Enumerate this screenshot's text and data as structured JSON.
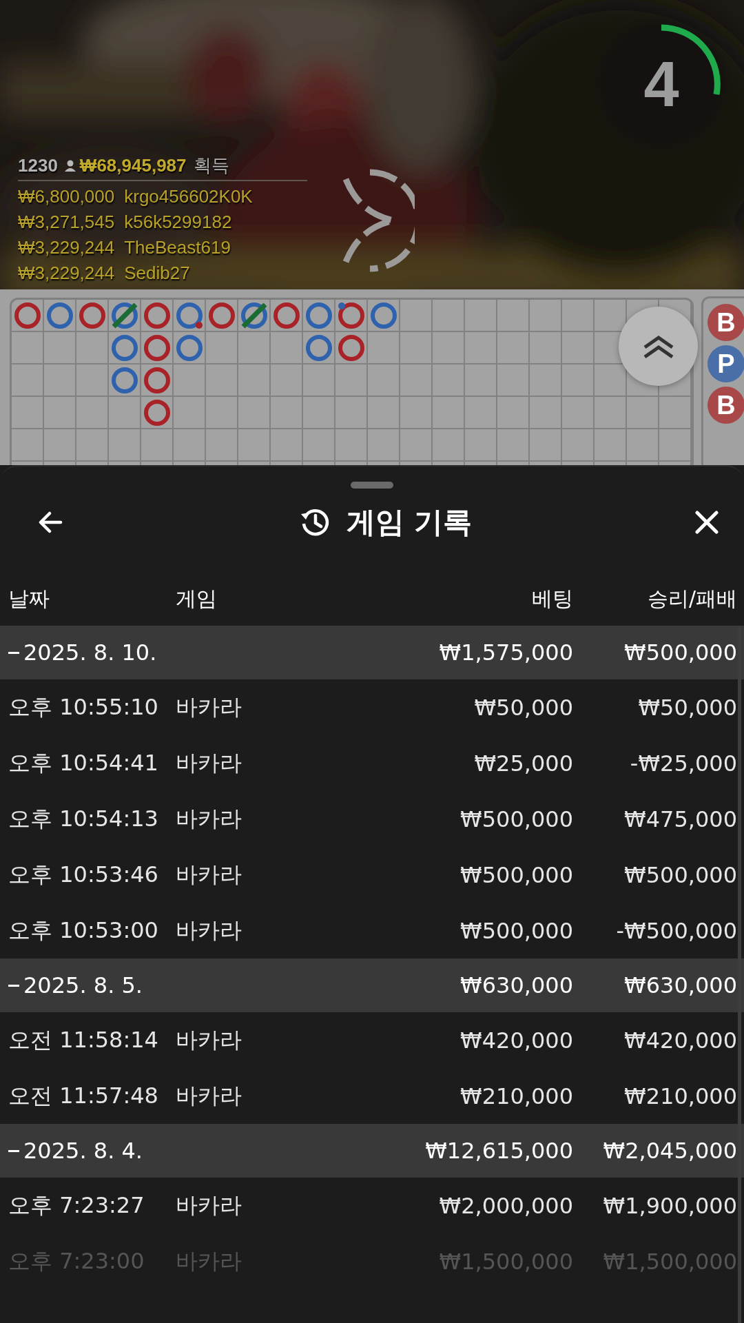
{
  "stream": {
    "kind": "picture",
    "countdown": {
      "value": "4"
    },
    "summary": {
      "players": "1230",
      "total": "₩68,945,987",
      "label": "획득"
    },
    "winners": [
      {
        "amount": "₩6,800,000",
        "name": "krgo456602K0K"
      },
      {
        "amount": "₩3,271,545",
        "name": "k56k5299182"
      },
      {
        "amount": "₩3,229,244",
        "name": "TheBeast619"
      },
      {
        "amount": "₩3,229,244",
        "name": "Sedib27"
      }
    ]
  },
  "bead_road": {
    "columns": [
      [
        {
          "kind": "banker",
          "tie": false,
          "banker_pair": false,
          "player_pair": false
        }
      ],
      [
        {
          "kind": "player",
          "tie": false,
          "banker_pair": false,
          "player_pair": false
        }
      ],
      [
        {
          "kind": "banker",
          "tie": false,
          "banker_pair": false,
          "player_pair": false
        }
      ],
      [
        {
          "kind": "player",
          "tie": true,
          "banker_pair": false,
          "player_pair": false
        },
        {
          "kind": "player",
          "tie": false,
          "banker_pair": false,
          "player_pair": false
        },
        {
          "kind": "player",
          "tie": false,
          "banker_pair": false,
          "player_pair": false
        }
      ],
      [
        {
          "kind": "banker",
          "tie": false,
          "banker_pair": false,
          "player_pair": false
        },
        {
          "kind": "banker",
          "tie": false,
          "banker_pair": false,
          "player_pair": false
        },
        {
          "kind": "banker",
          "tie": false,
          "banker_pair": false,
          "player_pair": false
        },
        {
          "kind": "banker",
          "tie": false,
          "banker_pair": false,
          "player_pair": false
        }
      ],
      [
        {
          "kind": "player",
          "tie": false,
          "banker_pair": true,
          "player_pair": false
        },
        {
          "kind": "player",
          "tie": false,
          "banker_pair": false,
          "player_pair": false
        }
      ],
      [
        {
          "kind": "banker",
          "tie": false,
          "banker_pair": false,
          "player_pair": false
        }
      ],
      [
        {
          "kind": "player",
          "tie": true,
          "banker_pair": false,
          "player_pair": false
        }
      ],
      [
        {
          "kind": "banker",
          "tie": false,
          "banker_pair": false,
          "player_pair": false
        }
      ],
      [
        {
          "kind": "player",
          "tie": false,
          "banker_pair": false,
          "player_pair": false
        },
        {
          "kind": "player",
          "tie": false,
          "banker_pair": false,
          "player_pair": false
        }
      ],
      [
        {
          "kind": "banker",
          "tie": false,
          "banker_pair": false,
          "player_pair": true
        },
        {
          "kind": "banker",
          "tie": false,
          "banker_pair": false,
          "player_pair": false
        }
      ],
      [
        {
          "kind": "player",
          "tie": false,
          "banker_pair": false,
          "player_pair": false
        }
      ]
    ],
    "side_panel": [
      {
        "label": "B",
        "kind": "banker"
      },
      {
        "label": "P",
        "kind": "player"
      },
      {
        "label": "B",
        "kind": "banker"
      }
    ]
  },
  "sheet": {
    "title": "게임 기록",
    "columns": [
      "날짜",
      "게임",
      "베팅",
      "승리/패배"
    ],
    "groups": [
      {
        "date": "2025. 8. 10.",
        "expanded": true,
        "bet": "₩1,575,000",
        "result": "₩500,000",
        "rows": [
          {
            "time": "오후 10:55:10",
            "game": "바카라",
            "bet": "₩50,000",
            "result": "₩50,000"
          },
          {
            "time": "오후 10:54:41",
            "game": "바카라",
            "bet": "₩25,000",
            "result": "-₩25,000"
          },
          {
            "time": "오후 10:54:13",
            "game": "바카라",
            "bet": "₩500,000",
            "result": "₩475,000"
          },
          {
            "time": "오후 10:53:46",
            "game": "바카라",
            "bet": "₩500,000",
            "result": "₩500,000"
          },
          {
            "time": "오후 10:53:00",
            "game": "바카라",
            "bet": "₩500,000",
            "result": "-₩500,000"
          }
        ]
      },
      {
        "date": "2025. 8. 5.",
        "expanded": true,
        "bet": "₩630,000",
        "result": "₩630,000",
        "rows": [
          {
            "time": "오전 11:58:14",
            "game": "바카라",
            "bet": "₩420,000",
            "result": "₩420,000"
          },
          {
            "time": "오전 11:57:48",
            "game": "바카라",
            "bet": "₩210,000",
            "result": "₩210,000"
          }
        ]
      },
      {
        "date": "2025. 8. 4.",
        "expanded": true,
        "bet": "₩12,615,000",
        "result": "₩2,045,000",
        "rows": [
          {
            "time": "오후 7:23:27",
            "game": "바카라",
            "bet": "₩2,000,000",
            "result": "₩1,900,000"
          },
          {
            "time": "오후 7:23:00",
            "game": "바카라",
            "bet": "₩1,500,000",
            "result": "₩1,500,000"
          }
        ]
      }
    ]
  }
}
